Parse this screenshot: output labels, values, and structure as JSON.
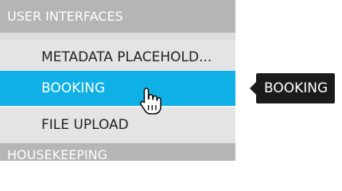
{
  "nav": {
    "section_user_interfaces": "USER INTERFACES",
    "items": [
      {
        "label": "METADATA PLACEHOLD..."
      },
      {
        "label": "BOOKING",
        "active": true
      },
      {
        "label": "FILE UPLOAD"
      }
    ],
    "section_housekeeping": "HOUSEKEEPING"
  },
  "tooltip": {
    "text": "BOOKING"
  },
  "colors": {
    "active_bg": "#0fb0e5",
    "section_bg": "#b5b5b5",
    "item_bg": "#e4e4e4",
    "tooltip_bg": "#1b1b1b"
  },
  "cursor": "hand-pointer-icon"
}
